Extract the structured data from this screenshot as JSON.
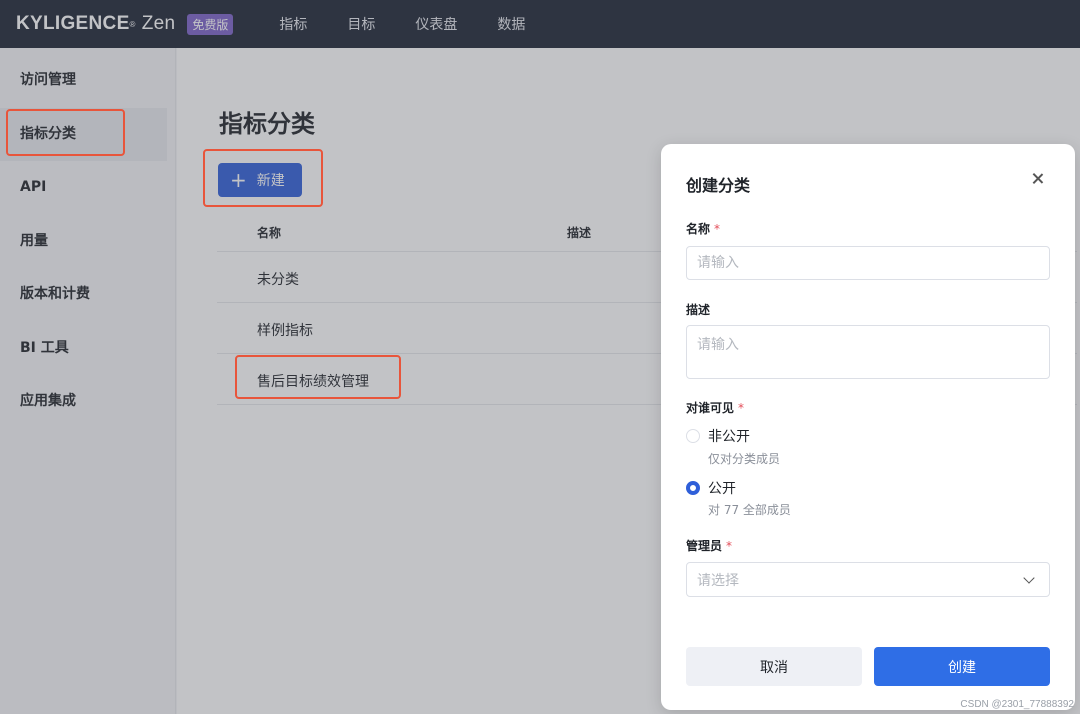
{
  "topbar": {
    "brand": "KYLIGENCE",
    "brand_sub": "Zen",
    "badge": "免费版",
    "nav": [
      "指标",
      "目标",
      "仪表盘",
      "数据"
    ]
  },
  "sidebar": {
    "items": [
      "访问管理",
      "指标分类",
      "API",
      "用量",
      "版本和计费",
      "BI 工具",
      "应用集成"
    ],
    "active": "指标分类"
  },
  "main": {
    "title": "指标分类",
    "new_button": "新建",
    "columns": [
      "名称",
      "描述"
    ],
    "rows": [
      "未分类",
      "样例指标",
      "售后目标绩效管理"
    ]
  },
  "dialog": {
    "title": "创建分类",
    "name_label": "名称",
    "name_placeholder": "请输入",
    "desc_label": "描述",
    "desc_placeholder": "请输入",
    "visibility_label": "对谁可见",
    "options": [
      {
        "label": "非公开",
        "hint": "仅对分类成员",
        "selected": false
      },
      {
        "label": "公开",
        "hint": "对 77 全部成员",
        "selected": true
      }
    ],
    "admin_label": "管理员",
    "admin_placeholder": "请选择",
    "required_mark": "*",
    "cancel": "取消",
    "create": "创建"
  },
  "watermark": "CSDN @2301_77888392",
  "colors": {
    "primary": "#2f5fd9",
    "highlight": "#e8553b",
    "topbar": "#1c2433"
  }
}
